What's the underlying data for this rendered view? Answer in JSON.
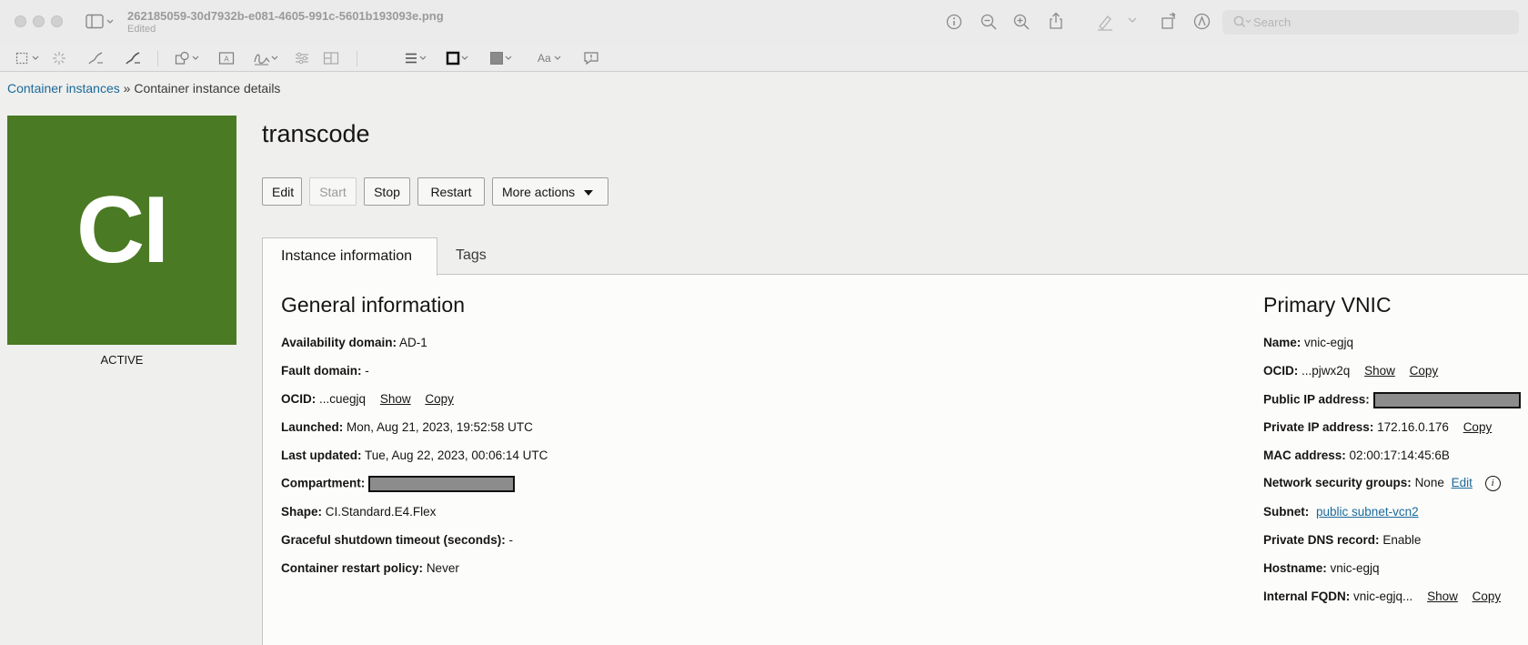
{
  "window": {
    "filename": "262185059-30d7932b-e081-4605-991c-5601b193093e.png",
    "status": "Edited",
    "search_placeholder": "Search"
  },
  "breadcrumb": {
    "parent": "Container instances",
    "separator": "»",
    "current": "Container instance details"
  },
  "avatar": {
    "initials": "CI",
    "state": "ACTIVE",
    "color": "#4a7a23"
  },
  "instance": {
    "name": "transcode"
  },
  "actions": {
    "edit": "Edit",
    "start": "Start",
    "stop": "Stop",
    "restart": "Restart",
    "more": "More actions"
  },
  "tabs": {
    "instance_info": "Instance information",
    "tags": "Tags"
  },
  "general": {
    "title": "General information",
    "availability_domain": {
      "label": "Availability domain:",
      "value": "AD-1"
    },
    "fault_domain": {
      "label": "Fault domain:",
      "value": "-"
    },
    "ocid": {
      "label": "OCID:",
      "value": "...cuegjq",
      "show": "Show",
      "copy": "Copy"
    },
    "launched": {
      "label": "Launched:",
      "value": "Mon, Aug 21, 2023, 19:52:58 UTC"
    },
    "last_updated": {
      "label": "Last updated:",
      "value": "Tue, Aug 22, 2023, 00:06:14 UTC"
    },
    "compartment": {
      "label": "Compartment:"
    },
    "shape": {
      "label": "Shape:",
      "value": "CI.Standard.E4.Flex"
    },
    "graceful_shutdown": {
      "label": "Graceful shutdown timeout (seconds):",
      "value": "-"
    },
    "restart_policy": {
      "label": "Container restart policy:",
      "value": "Never"
    }
  },
  "vnic": {
    "title": "Primary VNIC",
    "name": {
      "label": "Name:",
      "value": "vnic-egjq"
    },
    "ocid": {
      "label": "OCID:",
      "value": "...pjwx2q",
      "show": "Show",
      "copy": "Copy"
    },
    "public_ip": {
      "label": "Public IP address:"
    },
    "private_ip": {
      "label": "Private IP address:",
      "value": "172.16.0.176",
      "copy": "Copy"
    },
    "mac": {
      "label": "MAC address:",
      "value": "02:00:17:14:45:6B"
    },
    "nsg": {
      "label": "Network security groups:",
      "value": "None",
      "edit": "Edit"
    },
    "subnet": {
      "label": "Subnet:",
      "value": "public subnet-vcn2"
    },
    "dns": {
      "label": "Private DNS record:",
      "value": "Enable"
    },
    "hostname": {
      "label": "Hostname:",
      "value": "vnic-egjq"
    },
    "fqdn": {
      "label": "Internal FQDN:",
      "value": "vnic-egjq...",
      "show": "Show",
      "copy": "Copy"
    }
  }
}
